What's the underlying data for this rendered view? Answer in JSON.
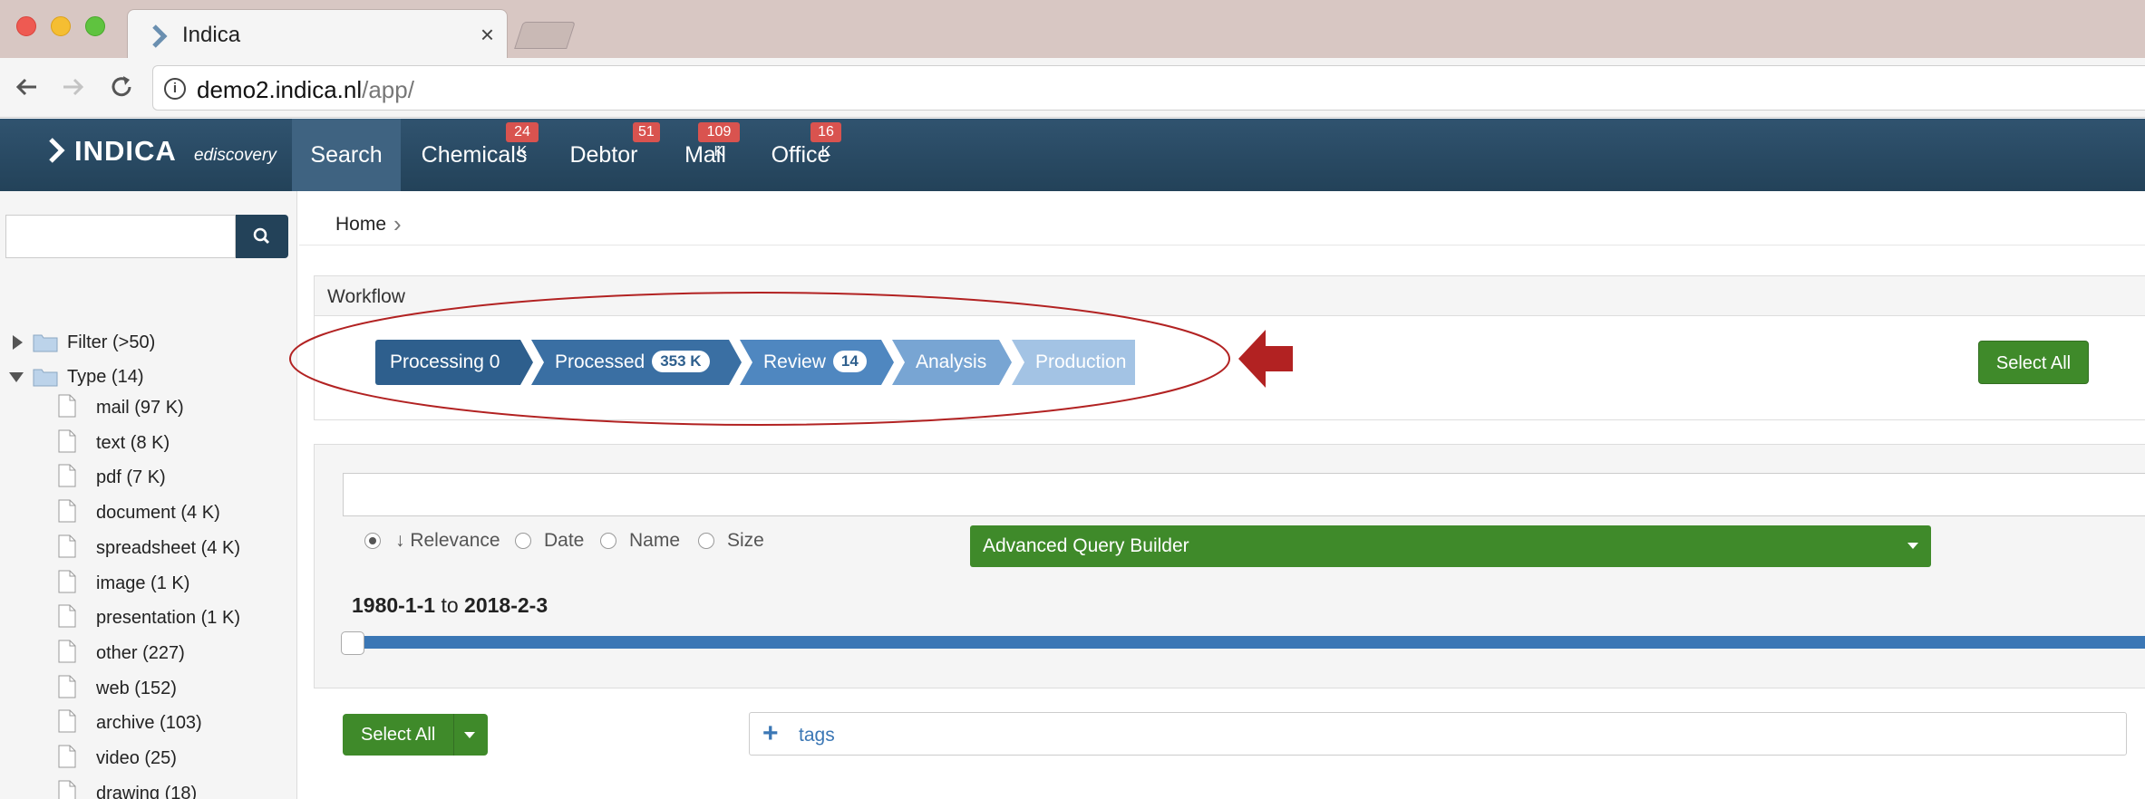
{
  "browser": {
    "tab_title": "Indica",
    "tab_close": "×",
    "url_host": "demo2.indica.nl",
    "url_path": "/app/"
  },
  "navbar": {
    "logo_text": "INDICA",
    "logo_sub": "ediscovery",
    "items": [
      {
        "label": "Search",
        "badge": ""
      },
      {
        "label": "Chemicals",
        "badge": "24 K"
      },
      {
        "label": "Debtor",
        "badge": "51"
      },
      {
        "label": "Mail",
        "badge": "109 K"
      },
      {
        "label": "Office",
        "badge": "16 K"
      }
    ]
  },
  "sidebar": {
    "tree": [
      {
        "label": "Filter (>50)",
        "expanded": false
      },
      {
        "label": "Type (14)",
        "expanded": true
      }
    ],
    "types": [
      "mail (97 K)",
      "text (8 K)",
      "pdf (7 K)",
      "document (4 K)",
      "spreadsheet (4 K)",
      "image (1 K)",
      "presentation (1 K)",
      "other (227)",
      "web (152)",
      "archive (103)",
      "video (25)",
      "drawing (18)"
    ]
  },
  "breadcrumb": {
    "home": "Home",
    "sep": "›"
  },
  "workflow": {
    "title": "Workflow",
    "steps": [
      {
        "label": "Processing 0",
        "badge": "",
        "color": "#2e5f8d"
      },
      {
        "label": "Processed",
        "badge": "353 K",
        "color": "#3a6fa3"
      },
      {
        "label": "Review",
        "badge": "14",
        "color": "#4f87c0"
      },
      {
        "label": "Analysis",
        "badge": "",
        "color": "#78a5d3"
      },
      {
        "label": "Production",
        "badge": "",
        "color": "#a3c3e4"
      }
    ],
    "select_all": "Select All"
  },
  "search": {
    "sort_options": [
      {
        "label": "↓ Relevance",
        "selected": true
      },
      {
        "label": "Date",
        "selected": false
      },
      {
        "label": "Name",
        "selected": false
      },
      {
        "label": "Size",
        "selected": false
      }
    ],
    "advanced_query_builder": "Advanced Query Builder",
    "date_from": "1980-1-1",
    "date_to_word": "to",
    "date_to": "2018-2-3",
    "select_all": "Select All",
    "tags_plus": "+",
    "tags_label": "tags"
  },
  "colors": {
    "navbar": "#2a4b66",
    "accent_green": "#3f8a2a",
    "badge_red": "#d9534f",
    "annotation_red": "#b22222"
  }
}
